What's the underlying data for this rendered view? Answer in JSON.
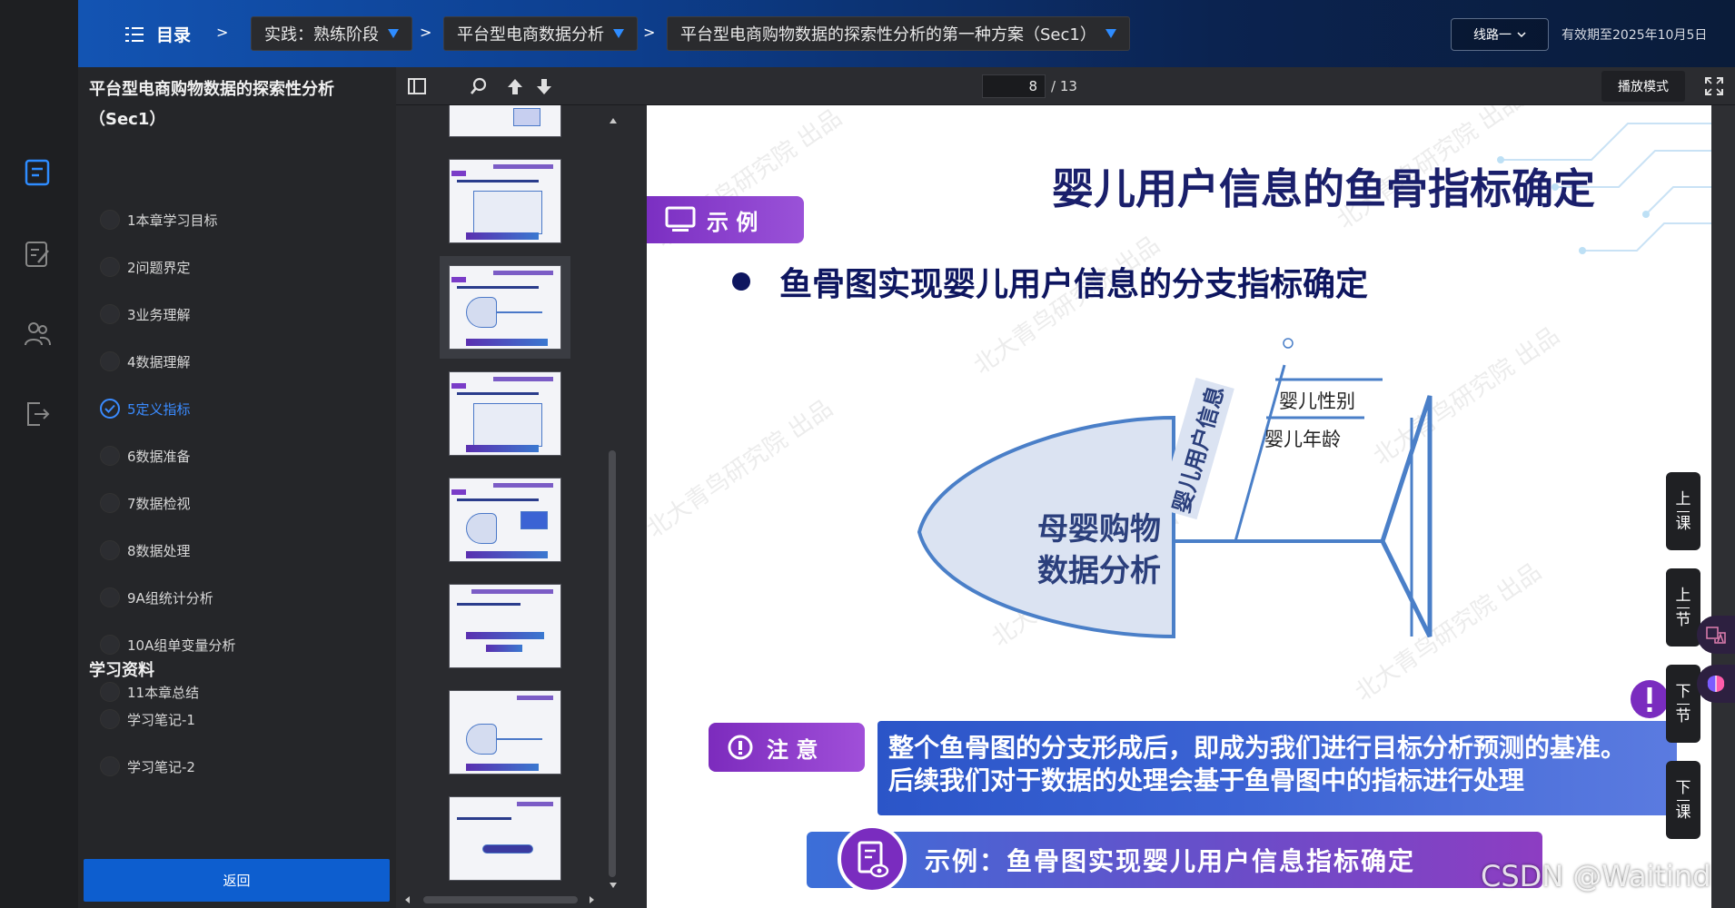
{
  "topbar": {
    "toc_label": "目录",
    "breadcrumbs": [
      "实践：熟练阶段",
      "平台型电商数据分析",
      "平台型电商购物数据的探索性分析的第一种方案（Sec1）"
    ],
    "separator": ">",
    "route_label": "线路一",
    "validity": "有效期至2025年10月5日"
  },
  "sidebar": {
    "course_title": "平台型电商购物数据的探索性分析（Sec1）",
    "chapters": [
      {
        "label": "1本章学习目标",
        "active": false
      },
      {
        "label": "2问题界定",
        "active": false
      },
      {
        "label": "3业务理解",
        "active": false
      },
      {
        "label": "4数据理解",
        "active": false
      },
      {
        "label": "5定义指标",
        "active": true
      },
      {
        "label": "6数据准备",
        "active": false
      },
      {
        "label": "7数据检视",
        "active": false
      },
      {
        "label": "8数据处理",
        "active": false
      },
      {
        "label": "9A组统计分析",
        "active": false
      },
      {
        "label": "10A组单变量分析",
        "active": false
      },
      {
        "label": "11本章总结",
        "active": false
      }
    ],
    "materials_title": "学习资料",
    "materials": [
      {
        "label": "学习笔记-1"
      },
      {
        "label": "学习笔记-2"
      }
    ],
    "back_label": "返回"
  },
  "viewer": {
    "page_current": "8",
    "page_total": "/ 13",
    "play_mode": "播放模式"
  },
  "slide": {
    "title": "婴儿用户信息的鱼骨指标确定",
    "example_tag": "示 例",
    "bullet": "鱼骨图实现婴儿用户信息的分支指标确定",
    "fish_head_line1": "母婴购物",
    "fish_head_line2": "数据分析",
    "branch_label": "婴儿用户信息",
    "branch_items": [
      "婴儿性别",
      "婴儿年龄"
    ],
    "note_tag": "注 意",
    "note_line1": "整个鱼骨图的分支形成后，即成为我们进行目标分析预测的基准。",
    "note_line2": "后续我们对于数据的处理会基于鱼骨图中的指标进行处理",
    "bottom_banner": "示例：鱼骨图实现婴儿用户信息指标确定",
    "watermark": "北大青鸟研究院 出品"
  },
  "side_nav": [
    {
      "top": "上",
      "bottom": "课"
    },
    {
      "top": "上",
      "bottom": "节"
    },
    {
      "top": "下",
      "bottom": "节"
    },
    {
      "top": "下",
      "bottom": "课"
    }
  ],
  "overlay": {
    "csdn": "CSDN @Waitind"
  }
}
